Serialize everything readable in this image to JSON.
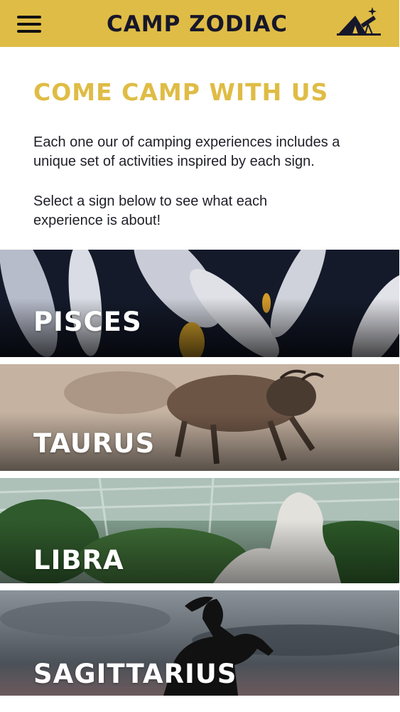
{
  "header": {
    "brand": "CAMP ZODIAC",
    "menu_icon": "hamburger-menu-icon",
    "logo_icon": "tent-telescope-icon",
    "accent": "#dfbc45"
  },
  "intro": {
    "heading": "COME CAMP WITH US",
    "paragraph1": "Each one our of camping experiences includes a unique set of activities inspired by each sign.",
    "paragraph2": "Select a sign below to see what each experience is about!"
  },
  "signs": [
    {
      "label": "PISCES"
    },
    {
      "label": "TAURUS"
    },
    {
      "label": "LIBRA"
    },
    {
      "label": "SAGITTARIUS"
    }
  ]
}
